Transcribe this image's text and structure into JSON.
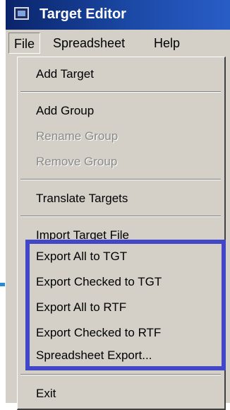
{
  "window": {
    "title": "Target Editor",
    "icon": "app-window-icon"
  },
  "menubar": {
    "items": [
      "File",
      "Spreadsheet",
      "Help"
    ],
    "active": "File"
  },
  "file_menu": {
    "items": [
      {
        "label": "Add Target",
        "enabled": true
      },
      {
        "label": "Add Group",
        "enabled": true
      },
      {
        "label": "Rename Group",
        "enabled": false
      },
      {
        "label": "Remove Group",
        "enabled": false
      },
      {
        "label": "Translate Targets",
        "enabled": true
      },
      {
        "label": "Import Target File",
        "enabled": true
      },
      {
        "label": "Export All to TGT",
        "enabled": true
      },
      {
        "label": "Export Checked to TGT",
        "enabled": true
      },
      {
        "label": "Export All to RTF",
        "enabled": true
      },
      {
        "label": "Export Checked to RTF",
        "enabled": true
      },
      {
        "label": "Spreadsheet Export...",
        "enabled": true
      },
      {
        "label": "Exit",
        "enabled": true
      }
    ]
  },
  "colors": {
    "title_bar": "#0a246a",
    "menu_face": "#d4d0c8",
    "disabled_text": "#8a8a8a",
    "highlight_box": "#4147c7"
  }
}
